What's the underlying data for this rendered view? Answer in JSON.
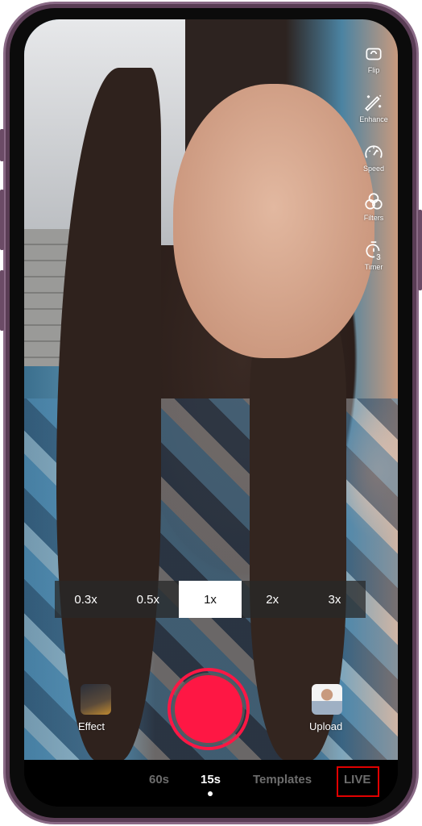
{
  "side_tools": [
    {
      "label": "Flip",
      "icon": "flip-camera-icon"
    },
    {
      "label": "Enhance",
      "icon": "magic-wand-icon"
    },
    {
      "label": "Speed",
      "icon": "speedometer-icon"
    },
    {
      "label": "Filters",
      "icon": "filters-icon"
    },
    {
      "label": "Timer",
      "icon": "timer-icon"
    }
  ],
  "zoom_levels": [
    "0.3x",
    "0.5x",
    "1x",
    "2x",
    "3x"
  ],
  "zoom_selected": "1x",
  "effect_label": "Effect",
  "upload_label": "Upload",
  "modes": [
    "60s",
    "15s",
    "Templates",
    "LIVE"
  ],
  "mode_selected": "15s",
  "colors": {
    "record": "#fe1744",
    "highlight_box": "#e10000"
  }
}
